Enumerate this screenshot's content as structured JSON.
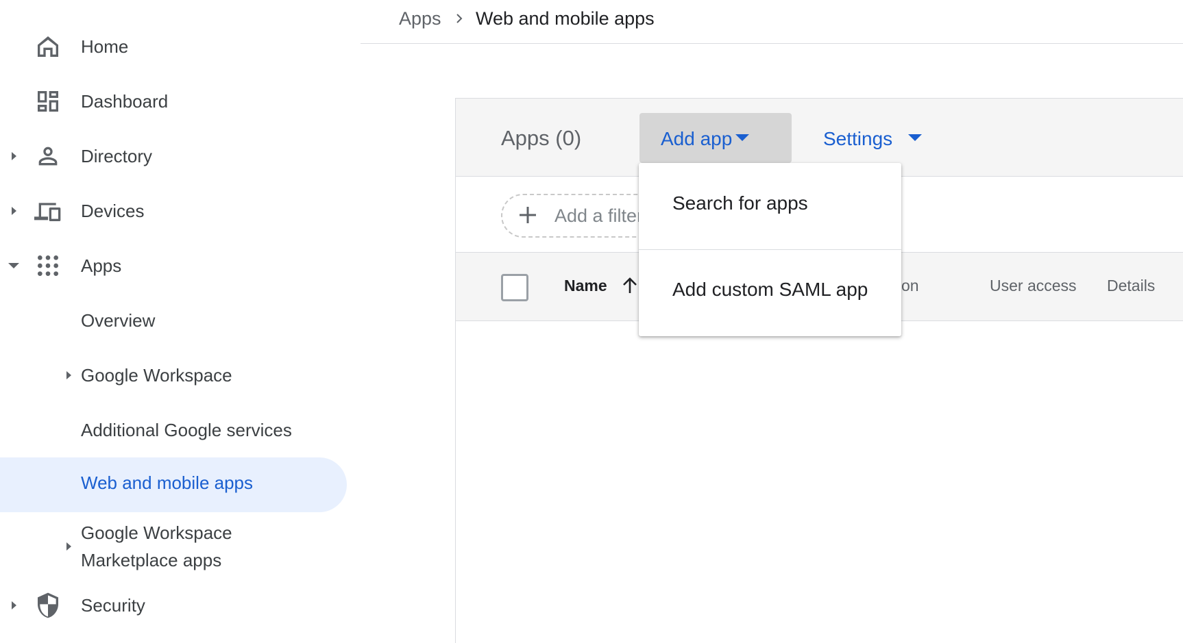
{
  "breadcrumb": {
    "root": "Apps",
    "current": "Web and mobile apps"
  },
  "sidebar": {
    "items": [
      {
        "label": "Home",
        "icon": "home-icon"
      },
      {
        "label": "Dashboard",
        "icon": "dashboard-icon"
      },
      {
        "label": "Directory",
        "icon": "person-icon"
      },
      {
        "label": "Devices",
        "icon": "devices-icon"
      },
      {
        "label": "Apps",
        "icon": "apps-grid-icon"
      },
      {
        "label": "Security",
        "icon": "shield-icon"
      }
    ],
    "apps_children": {
      "overview": "Overview",
      "google_workspace": "Google Workspace",
      "additional": "Additional Google services",
      "web_mobile": "Web and mobile apps",
      "marketplace_line1": "Google Workspace",
      "marketplace_line2": "Marketplace apps"
    }
  },
  "card": {
    "title": "Apps (0)",
    "add_app_label": "Add app",
    "settings_label": "Settings",
    "filter_label": "Add a filter"
  },
  "table": {
    "headers": {
      "name": "Name",
      "partial": "on",
      "user_access": "User access",
      "details": "Details"
    }
  },
  "menu": {
    "items": [
      "Search for apps",
      "Add custom SAML app"
    ]
  },
  "colors": {
    "accent": "#1a5fd0",
    "active_bg": "#e8f0fe",
    "header_bg": "#f5f5f5"
  }
}
